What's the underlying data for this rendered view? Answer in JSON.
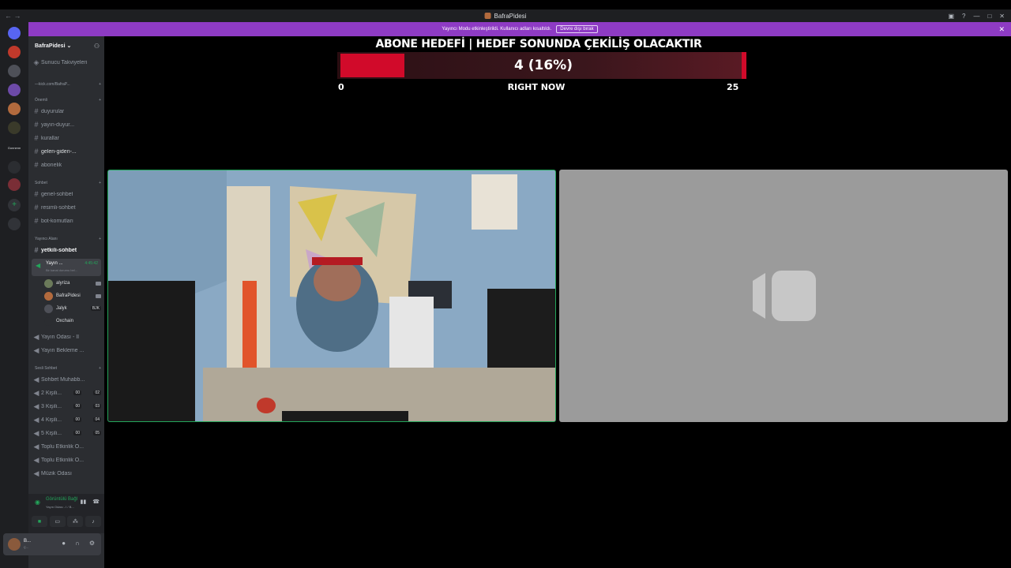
{
  "window": {
    "title": "BafraPidesi"
  },
  "notice": {
    "text": "Yayıncı Modu etkinleştirildi. Kullanıcı adları kısaltıldı.",
    "button": "Devre dışı bırak"
  },
  "server_list": {
    "label": "Gonnenn"
  },
  "server": {
    "name": "BafraPidesi",
    "boosts": "Sunucu Takviyeleri",
    "link_category": "—kick.com/BafraP...",
    "categories": [
      {
        "label": "Önemli"
      },
      {
        "label": "Sohbet"
      },
      {
        "label": "Yayıncı Alanı"
      },
      {
        "label": "Sesli Sohbet"
      }
    ],
    "channels_important": [
      "duyurular",
      "yayın-duyur...",
      "kurallar",
      "gelen-giden-...",
      "abonelik"
    ],
    "channels_chat": [
      "genel-sohbet",
      "resimli-sohbet",
      "bot-komutları"
    ],
    "channel_staff": "yetkili-sohbet",
    "active_voice": {
      "name": "Yayın ...",
      "time": "4:45:42",
      "subtitle": "Bir kanal durumu bel..."
    },
    "members": [
      {
        "name": "alyriza"
      },
      {
        "name": "BafraPidesi"
      },
      {
        "name": "Jalyk",
        "badge": "BJK"
      },
      {
        "name": "Oxchain"
      }
    ],
    "voice_rooms": [
      "Yayın Odası - II",
      "Yayın Bekleme ..."
    ],
    "voice_chat": [
      {
        "name": "Sohbet Muhabb..."
      },
      {
        "name": "2 Kişili...",
        "a": "00",
        "b": "02"
      },
      {
        "name": "3 Kişili...",
        "a": "00",
        "b": "03"
      },
      {
        "name": "4 Kişili...",
        "a": "00",
        "b": "04"
      },
      {
        "name": "5 Kişili...",
        "a": "00",
        "b": "05"
      },
      {
        "name": "Toplu Etkinlik O..."
      },
      {
        "name": "Toplu Etkinlik O..."
      },
      {
        "name": "Müzik Odası"
      }
    ]
  },
  "voice_panel": {
    "status": "Görüntülü Bağl",
    "subtitle": "Yayın Odası - I / B..."
  },
  "user": {
    "name": "B...",
    "status": "Ç..."
  },
  "goal": {
    "title": "ABONE HEDEFİ | HEDEF SONUNDA ÇEKİLİŞ OLACAKTIR",
    "value_text": "4 (16%)",
    "current": 4,
    "max": 25,
    "min_label": "0",
    "max_label": "25",
    "now_label": "RIGHT NOW",
    "color": "#d10a2a"
  }
}
